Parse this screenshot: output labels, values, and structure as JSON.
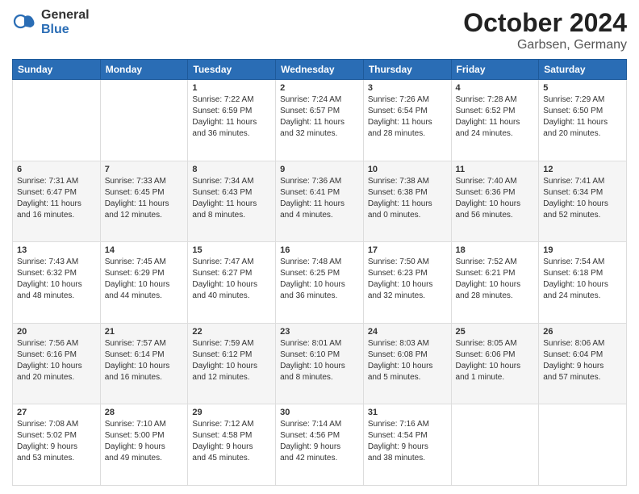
{
  "logo": {
    "general": "General",
    "blue": "Blue"
  },
  "header": {
    "month": "October 2024",
    "location": "Garbsen, Germany"
  },
  "weekdays": [
    "Sunday",
    "Monday",
    "Tuesday",
    "Wednesday",
    "Thursday",
    "Friday",
    "Saturday"
  ],
  "weeks": [
    [
      {
        "day": "",
        "info": ""
      },
      {
        "day": "",
        "info": ""
      },
      {
        "day": "1",
        "info": "Sunrise: 7:22 AM\nSunset: 6:59 PM\nDaylight: 11 hours\nand 36 minutes."
      },
      {
        "day": "2",
        "info": "Sunrise: 7:24 AM\nSunset: 6:57 PM\nDaylight: 11 hours\nand 32 minutes."
      },
      {
        "day": "3",
        "info": "Sunrise: 7:26 AM\nSunset: 6:54 PM\nDaylight: 11 hours\nand 28 minutes."
      },
      {
        "day": "4",
        "info": "Sunrise: 7:28 AM\nSunset: 6:52 PM\nDaylight: 11 hours\nand 24 minutes."
      },
      {
        "day": "5",
        "info": "Sunrise: 7:29 AM\nSunset: 6:50 PM\nDaylight: 11 hours\nand 20 minutes."
      }
    ],
    [
      {
        "day": "6",
        "info": "Sunrise: 7:31 AM\nSunset: 6:47 PM\nDaylight: 11 hours\nand 16 minutes."
      },
      {
        "day": "7",
        "info": "Sunrise: 7:33 AM\nSunset: 6:45 PM\nDaylight: 11 hours\nand 12 minutes."
      },
      {
        "day": "8",
        "info": "Sunrise: 7:34 AM\nSunset: 6:43 PM\nDaylight: 11 hours\nand 8 minutes."
      },
      {
        "day": "9",
        "info": "Sunrise: 7:36 AM\nSunset: 6:41 PM\nDaylight: 11 hours\nand 4 minutes."
      },
      {
        "day": "10",
        "info": "Sunrise: 7:38 AM\nSunset: 6:38 PM\nDaylight: 11 hours\nand 0 minutes."
      },
      {
        "day": "11",
        "info": "Sunrise: 7:40 AM\nSunset: 6:36 PM\nDaylight: 10 hours\nand 56 minutes."
      },
      {
        "day": "12",
        "info": "Sunrise: 7:41 AM\nSunset: 6:34 PM\nDaylight: 10 hours\nand 52 minutes."
      }
    ],
    [
      {
        "day": "13",
        "info": "Sunrise: 7:43 AM\nSunset: 6:32 PM\nDaylight: 10 hours\nand 48 minutes."
      },
      {
        "day": "14",
        "info": "Sunrise: 7:45 AM\nSunset: 6:29 PM\nDaylight: 10 hours\nand 44 minutes."
      },
      {
        "day": "15",
        "info": "Sunrise: 7:47 AM\nSunset: 6:27 PM\nDaylight: 10 hours\nand 40 minutes."
      },
      {
        "day": "16",
        "info": "Sunrise: 7:48 AM\nSunset: 6:25 PM\nDaylight: 10 hours\nand 36 minutes."
      },
      {
        "day": "17",
        "info": "Sunrise: 7:50 AM\nSunset: 6:23 PM\nDaylight: 10 hours\nand 32 minutes."
      },
      {
        "day": "18",
        "info": "Sunrise: 7:52 AM\nSunset: 6:21 PM\nDaylight: 10 hours\nand 28 minutes."
      },
      {
        "day": "19",
        "info": "Sunrise: 7:54 AM\nSunset: 6:18 PM\nDaylight: 10 hours\nand 24 minutes."
      }
    ],
    [
      {
        "day": "20",
        "info": "Sunrise: 7:56 AM\nSunset: 6:16 PM\nDaylight: 10 hours\nand 20 minutes."
      },
      {
        "day": "21",
        "info": "Sunrise: 7:57 AM\nSunset: 6:14 PM\nDaylight: 10 hours\nand 16 minutes."
      },
      {
        "day": "22",
        "info": "Sunrise: 7:59 AM\nSunset: 6:12 PM\nDaylight: 10 hours\nand 12 minutes."
      },
      {
        "day": "23",
        "info": "Sunrise: 8:01 AM\nSunset: 6:10 PM\nDaylight: 10 hours\nand 8 minutes."
      },
      {
        "day": "24",
        "info": "Sunrise: 8:03 AM\nSunset: 6:08 PM\nDaylight: 10 hours\nand 5 minutes."
      },
      {
        "day": "25",
        "info": "Sunrise: 8:05 AM\nSunset: 6:06 PM\nDaylight: 10 hours\nand 1 minute."
      },
      {
        "day": "26",
        "info": "Sunrise: 8:06 AM\nSunset: 6:04 PM\nDaylight: 9 hours\nand 57 minutes."
      }
    ],
    [
      {
        "day": "27",
        "info": "Sunrise: 7:08 AM\nSunset: 5:02 PM\nDaylight: 9 hours\nand 53 minutes."
      },
      {
        "day": "28",
        "info": "Sunrise: 7:10 AM\nSunset: 5:00 PM\nDaylight: 9 hours\nand 49 minutes."
      },
      {
        "day": "29",
        "info": "Sunrise: 7:12 AM\nSunset: 4:58 PM\nDaylight: 9 hours\nand 45 minutes."
      },
      {
        "day": "30",
        "info": "Sunrise: 7:14 AM\nSunset: 4:56 PM\nDaylight: 9 hours\nand 42 minutes."
      },
      {
        "day": "31",
        "info": "Sunrise: 7:16 AM\nSunset: 4:54 PM\nDaylight: 9 hours\nand 38 minutes."
      },
      {
        "day": "",
        "info": ""
      },
      {
        "day": "",
        "info": ""
      }
    ]
  ]
}
